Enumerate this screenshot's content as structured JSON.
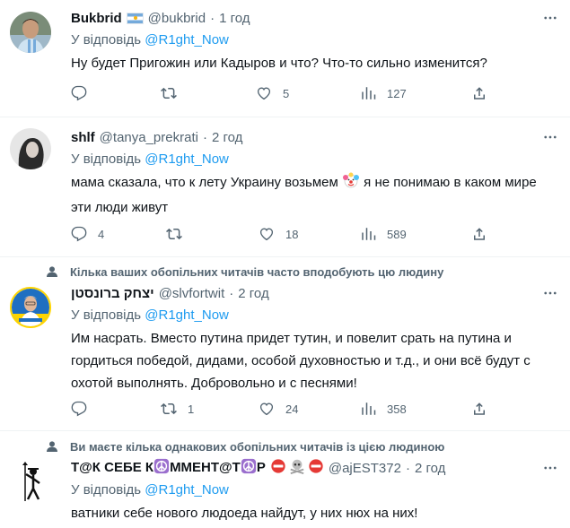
{
  "tweets": [
    {
      "name": "Bukbrid",
      "has_flag": true,
      "handle": "@bukbrid",
      "dot": "·",
      "time": "1 год",
      "reply_prefix": "У відповідь ",
      "reply_to": "@R1ght_Now",
      "text": "Ну будет Пригожин или Кадыров и что? Что-то сильно изменится?",
      "replies": "",
      "retweets": "",
      "likes": "5",
      "views": "127"
    },
    {
      "name": "shlf",
      "handle": "@tanya_prekrati",
      "dot": "·",
      "time": "2 год",
      "reply_prefix": "У відповідь ",
      "reply_to": "@R1ght_Now",
      "text_before_emoji": "мама сказала, что к лету Украину возьмем ",
      "text_after_emoji": " я не понимаю в каком мире эти люди живут",
      "replies": "4",
      "retweets": "",
      "likes": "18",
      "views": "589"
    },
    {
      "social_context": "Кілька ваших обопільних читачів часто вподобують цю людину",
      "name": "יצחק ברונסטן",
      "handle": "@slvfortwit",
      "dot": "·",
      "time": "2 год",
      "reply_prefix": "У відповідь ",
      "reply_to": "@R1ght_Now",
      "text": "Им насрать. Вместо путина придет тутин, и повелит срать на путина и гордиться победой, дидами, особой духовностью и т.д., и они всё будут с охотой выполнять. Добровольно и с песнями!",
      "replies": "",
      "retweets": "1",
      "likes": "24",
      "views": "358"
    },
    {
      "social_context": "Ви маєте кілька однакових обопільних читачів із цією людиною",
      "name_part1": "Т@К СЕБЕ К",
      "name_part2": "ММЕНТ@Т",
      "name_part3": "Р",
      "handle": "@ajEST372",
      "dot": "·",
      "time": "2 год",
      "reply_prefix": "У відповідь ",
      "reply_to": "@R1ght_Now",
      "text": "ватники себе нового людоеда найдут, у них нюх на них!"
    }
  ],
  "more_label": "···",
  "colors": {
    "link": "#1d9bf0",
    "muted": "#536471",
    "text": "#0f1419",
    "divider": "#eff3f4"
  },
  "icons": [
    "reply-icon",
    "retweet-icon",
    "like-icon",
    "views-icon",
    "share-icon",
    "more-icon",
    "person-icon",
    "people-icon"
  ]
}
